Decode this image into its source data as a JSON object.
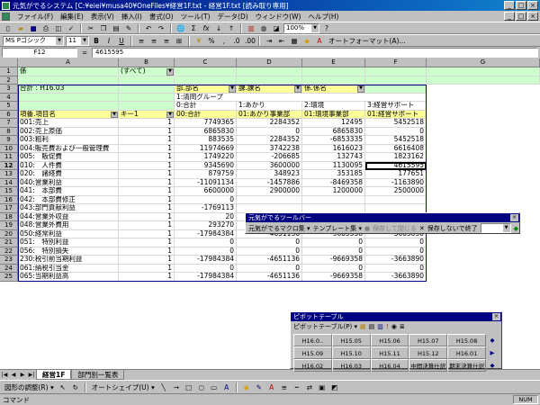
{
  "window": {
    "title": "元気がでるシステム  [C:¥eiei¥musa40¥OneFiles¥経営1F.txt - 経営1F.txt  [読み取り専用]",
    "buttons": [
      "_",
      "□",
      "×"
    ]
  },
  "menu": {
    "items": [
      "ファイル(F)",
      "編集(E)",
      "表示(V)",
      "挿入(I)",
      "書式(O)",
      "ツール(T)",
      "データ(D)",
      "ウィンドウ(W)",
      "ヘルプ(H)"
    ],
    "mdi_buttons": [
      "_",
      "□",
      "×"
    ]
  },
  "toolbar_standard": {
    "zoom": "100%"
  },
  "toolbar_format": {
    "font": "MS Pゴシック",
    "size": "11",
    "autoformat": "オートフォーマット(A)..."
  },
  "formula_bar": {
    "name_box": "F12",
    "eq": "=",
    "value": "4615595"
  },
  "columns": [
    "A",
    "B",
    "C",
    "D",
    "E",
    "F",
    "G"
  ],
  "rows": {
    "r1": {
      "a": "係",
      "b": "(すべて)"
    },
    "r3": {
      "a": "合計 : H16.03",
      "c": "部.部名",
      "d": "課.課名",
      "e": "係.係名"
    },
    "r4": {
      "c": "1:清岡グループ"
    },
    "r5": {
      "c": "0:合計",
      "d": "1:あかり",
      "e": "2:環境",
      "f": "3:経営サポート"
    },
    "r6": {
      "a": "項番.項目名",
      "b": "キー1",
      "c": "00:合計",
      "d": "01:あかり事業部",
      "e": "01:環境事業部",
      "f": "01:経営サポート"
    }
  },
  "data_rows": [
    {
      "a": "001:売上",
      "b": "1",
      "c": "7749365",
      "d": "2284352",
      "e": "12495",
      "f": "5452518"
    },
    {
      "a": "002:売上原価",
      "b": "1",
      "c": "6865830",
      "d": "0",
      "e": "6865830",
      "f": "0"
    },
    {
      "a": "003:粗利",
      "b": "1",
      "c": "883535",
      "d": "2284352",
      "e": "-6853335",
      "f": "5452518"
    },
    {
      "a": "004:販売費および一般管理費",
      "b": "1",
      "c": "11974669",
      "d": "3742238",
      "e": "1616023",
      "f": "6616408"
    },
    {
      "a": "005:　販促費",
      "b": "1",
      "c": "1749220",
      "d": "-206685",
      "e": "132743",
      "f": "1823162"
    },
    {
      "a": "010:　人件費",
      "b": "1",
      "c": "9345690",
      "d": "3600000",
      "e": "1130095",
      "f": "4615595"
    },
    {
      "a": "020:　諸経費",
      "b": "1",
      "c": "879759",
      "d": "348923",
      "e": "353185",
      "f": "177651"
    },
    {
      "a": "040:営業利益",
      "b": "1",
      "c": "-11091134",
      "d": "-1457886",
      "e": "-8469358",
      "f": "-1163890"
    },
    {
      "a": "041:　本部費",
      "b": "1",
      "c": "6600000",
      "d": "2900000",
      "e": "1200000",
      "f": "2500000"
    },
    {
      "a": "042:　本部費修正",
      "b": "1",
      "c": "0",
      "d": "",
      "e": "",
      "f": ""
    },
    {
      "a": "043:部門貢献利益",
      "b": "1",
      "c": "-1769113",
      "d": "",
      "e": "",
      "f": ""
    },
    {
      "a": "044:営業外収益",
      "b": "1",
      "c": "20",
      "d": "",
      "e": "",
      "f": ""
    },
    {
      "a": "048:営業外費用",
      "b": "1",
      "c": "293270",
      "d": "293270",
      "e": "0",
      "f": "0"
    },
    {
      "a": "050:経常利益",
      "b": "1",
      "c": "-17984384",
      "d": "-4651136",
      "e": "-9669358",
      "f": "-3663890"
    },
    {
      "a": "051:　特別利益",
      "b": "1",
      "c": "0",
      "d": "0",
      "e": "0",
      "f": "0"
    },
    {
      "a": "056:　特別損失",
      "b": "1",
      "c": "0",
      "d": "0",
      "e": "0",
      "f": "0"
    },
    {
      "a": "230:税引前当期利益",
      "b": "1",
      "c": "-17984384",
      "d": "-4651136",
      "e": "-9669358",
      "f": "-3663890"
    },
    {
      "a": "061:納税引当金",
      "b": "1",
      "c": "0",
      "d": "0",
      "e": "0",
      "f": "0"
    },
    {
      "a": "065:当期利益高",
      "b": "1",
      "c": "-17984384",
      "d": "-4651136",
      "e": "-9669358",
      "f": "-3663890"
    }
  ],
  "genki_toolbar": {
    "title": "元気がでるツールバー",
    "macro": "元気がでるマクロ集 ▾",
    "template": "テンプレート集 ▾",
    "save_close": "保存して閉じる",
    "close_nosave": "保存しないで終了"
  },
  "pivot_toolbar": {
    "title": "ピボットテーブル",
    "menu": "ピボットテーブル(P) ▾",
    "fields": [
      "H16.0..",
      "H15.05",
      "H15.06",
      "H15.07",
      "H15.08",
      "",
      "H15.09",
      "H15.10",
      "H15.11",
      "H15.12",
      "H16.01",
      "",
      "H16.02",
      "H16.03",
      "H16.04",
      "中間決算仕訳",
      "期末決算仕訳",
      ""
    ]
  },
  "sheet_tabs": [
    "経営1F",
    "部門別一覧表"
  ],
  "draw_toolbar": {
    "draw": "図形の調整(R) ▾",
    "autoshape": "オートシェイプ(U) ▾"
  },
  "status": {
    "text": "コマンド",
    "num": "NUM"
  },
  "colors": {
    "pivot_header": "#ffff99",
    "pivot_area": "#ccffcc",
    "titlebar": "#000080"
  }
}
